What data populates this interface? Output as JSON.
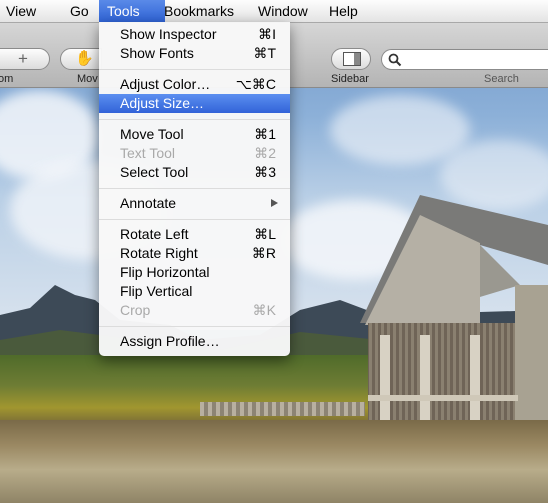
{
  "menubar": {
    "items": [
      "View",
      "Go",
      "Tools",
      "Bookmarks",
      "Window",
      "Help"
    ],
    "active_index": 2
  },
  "toolbar": {
    "zoom_label": "om",
    "move_label": "Mov",
    "sidebar_label": "Sidebar",
    "search_label": "Search",
    "add_icon": "plus-icon",
    "hand_icon": "hand-icon",
    "sidebar_icon": "sidebar-icon",
    "search_icon": "magnifier-icon"
  },
  "tools_menu": {
    "items": [
      {
        "label": "Show Inspector",
        "shortcut": "⌘I",
        "enabled": true
      },
      {
        "label": "Show Fonts",
        "shortcut": "⌘T",
        "enabled": true
      },
      {
        "label": "Adjust Color…",
        "shortcut": "⌥⌘C",
        "enabled": true
      },
      {
        "label": "Adjust Size…",
        "shortcut": "",
        "enabled": true,
        "highlighted": true
      },
      {
        "label": "Move Tool",
        "shortcut": "⌘1",
        "enabled": true
      },
      {
        "label": "Text Tool",
        "shortcut": "⌘2",
        "enabled": false
      },
      {
        "label": "Select Tool",
        "shortcut": "⌘3",
        "enabled": true
      },
      {
        "label": "Annotate",
        "shortcut": "",
        "enabled": true,
        "submenu": true
      },
      {
        "label": "Rotate Left",
        "shortcut": "⌘L",
        "enabled": true
      },
      {
        "label": "Rotate Right",
        "shortcut": "⌘R",
        "enabled": true
      },
      {
        "label": "Flip Horizontal",
        "shortcut": "",
        "enabled": true
      },
      {
        "label": "Flip Vertical",
        "shortcut": "",
        "enabled": true
      },
      {
        "label": "Crop",
        "shortcut": "⌘K",
        "enabled": false
      },
      {
        "label": "Assign Profile…",
        "shortcut": "",
        "enabled": true
      }
    ]
  },
  "colors": {
    "menu_highlight": "#3a6fe0",
    "disabled_text": "#a9a9a9"
  }
}
